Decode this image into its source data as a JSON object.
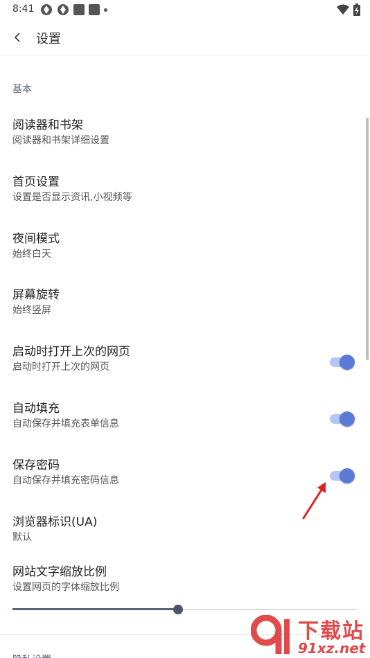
{
  "status_bar": {
    "time": "8:41",
    "left_icons": [
      "app-notification-icon",
      "app-notification-icon",
      "square-notification-icon",
      "square-notification-icon",
      "more-dot-icon"
    ],
    "right_icons": [
      "wifi-icon",
      "battery-charging-icon"
    ]
  },
  "app_bar": {
    "back_icon": "chevron-left-icon",
    "title": "设置"
  },
  "sections": [
    {
      "header": "基本",
      "items": [
        {
          "title": "阅读器和书架",
          "subtitle": "阅读器和书架详细设置"
        },
        {
          "title": "首页设置",
          "subtitle": "设置是否显示资讯,小视频等"
        },
        {
          "title": "夜间模式",
          "subtitle": "始终白天"
        },
        {
          "title": "屏幕旋转",
          "subtitle": "始终竖屏"
        },
        {
          "title": "启动时打开上次的网页",
          "subtitle": "启动时打开上次的网页",
          "toggle": true
        },
        {
          "title": "自动填充",
          "subtitle": "自动保存并填充表单信息",
          "toggle": true
        },
        {
          "title": "保存密码",
          "subtitle": "自动保存并填充密码信息",
          "toggle": true
        },
        {
          "title": "浏览器标识(UA)",
          "subtitle": "默认"
        },
        {
          "title": "网站文字缩放比例",
          "subtitle": "设置网页的字体缩放比例",
          "slider_fraction": 0.48
        }
      ]
    }
  ],
  "next_section_header_partial": "隐私设置",
  "colors": {
    "accent": "#5b7ad6",
    "toggle_track": "#b5c6f4",
    "section_header": "#5a6378",
    "annotation_arrow": "#e02020",
    "watermark": "#e04a4a"
  },
  "watermark": {
    "top": "下载站",
    "bottom": "91xz.net"
  }
}
